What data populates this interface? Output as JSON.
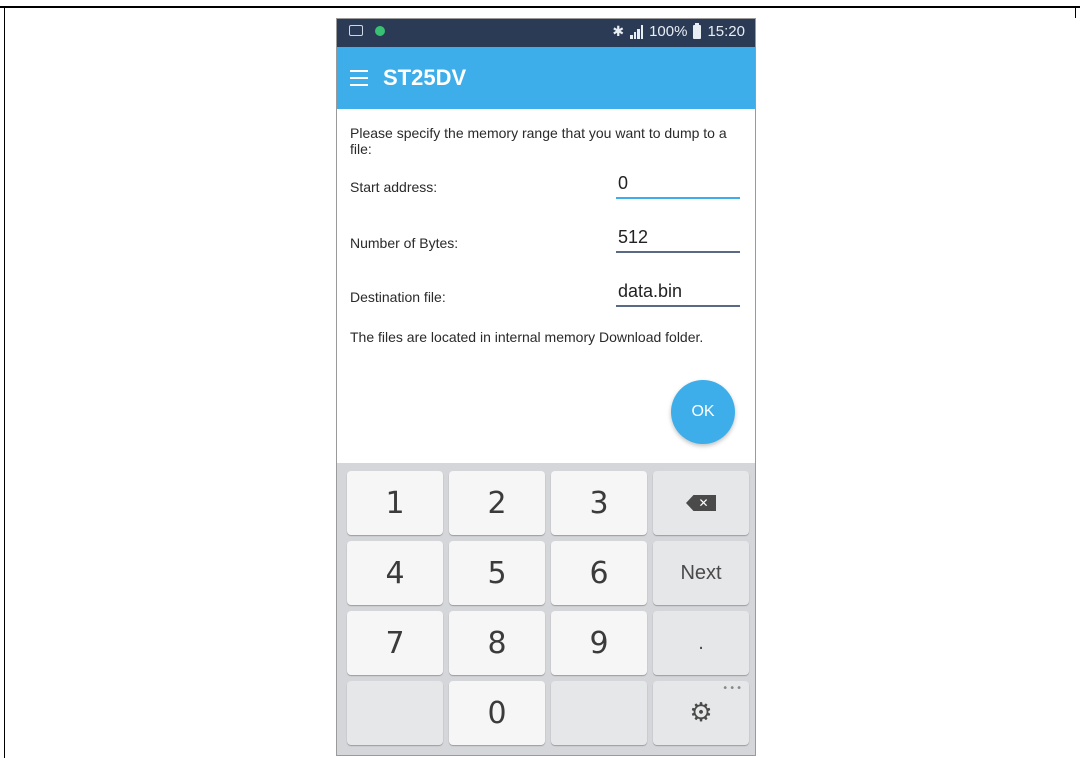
{
  "status_bar": {
    "battery": "100%",
    "time": "15:20",
    "icons": [
      "message-icon",
      "notification-dot-icon",
      "bluetooth-icon",
      "signal-icon",
      "battery-icon"
    ]
  },
  "app_bar": {
    "title": "ST25DV",
    "menu_icon": "hamburger-menu-icon",
    "color": "#3daee9"
  },
  "form": {
    "instructions": "Please specify the memory range that you want to dump to a file:",
    "start_address": {
      "label": "Start address:",
      "value": "0"
    },
    "number_of_bytes": {
      "label": "Number of Bytes:",
      "value": "512"
    },
    "destination_file": {
      "label": "Destination file:",
      "value": "data.bin"
    },
    "location_note": "The files are located in internal memory Download folder.",
    "ok_label": "OK"
  },
  "keyboard": {
    "keys": {
      "k1": "1",
      "k2": "2",
      "k3": "3",
      "k4": "4",
      "k5": "5",
      "k6": "6",
      "k7": "7",
      "k8": "8",
      "k9": "9",
      "k0": "0",
      "next": "Next",
      "period": "."
    },
    "backspace_symbol": "✕",
    "settings_icon": "gear-icon"
  }
}
